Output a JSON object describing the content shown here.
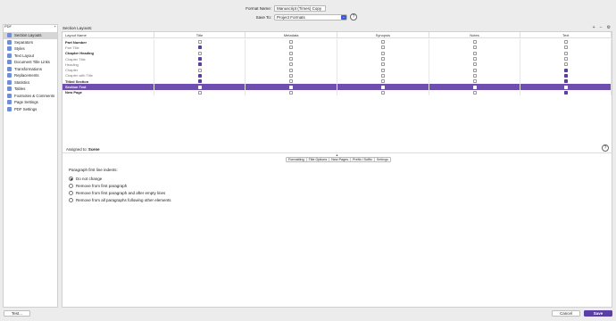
{
  "header": {
    "format_name_label": "Format Name:",
    "format_name_value": "Manuscript (Times) Copy",
    "save_to_label": "Save To:",
    "save_to_value": "Project Formats"
  },
  "sidebar": {
    "label": "PDF",
    "items": [
      {
        "label": "Section Layouts",
        "icon": "layout-icon",
        "selected": true
      },
      {
        "label": "Separators",
        "icon": "separator-icon"
      },
      {
        "label": "Styles",
        "icon": "styles-icon"
      },
      {
        "label": "Text Layout",
        "icon": "text-layout-icon"
      },
      {
        "label": "Document Title Links",
        "icon": "link-icon"
      },
      {
        "label": "Transformations",
        "icon": "transform-icon"
      },
      {
        "label": "Replacements",
        "icon": "replace-icon"
      },
      {
        "label": "Statistics",
        "icon": "stats-icon"
      },
      {
        "label": "Tables",
        "icon": "table-icon"
      },
      {
        "label": "Footnotes & Comments",
        "icon": "footnote-icon"
      },
      {
        "label": "Page Settings",
        "icon": "page-icon"
      },
      {
        "label": "PDF Settings",
        "icon": "pdf-icon"
      }
    ]
  },
  "main": {
    "title": "Section Layouts:",
    "columns": [
      "Layout Name",
      "Title",
      "Metadata",
      "Synopsis",
      "Notes",
      "Text"
    ],
    "rows": [
      {
        "name": "Part Number",
        "style": "bold",
        "checks": [
          false,
          false,
          false,
          false,
          false
        ],
        "selected": false
      },
      {
        "name": "Part Title",
        "style": "gray",
        "checks": [
          true,
          false,
          false,
          false,
          false
        ],
        "selected": false
      },
      {
        "name": "Chapter Heading",
        "style": "bold",
        "checks": [
          false,
          false,
          false,
          false,
          false
        ],
        "selected": false
      },
      {
        "name": "Chapter Title",
        "style": "gray",
        "checks": [
          true,
          false,
          false,
          false,
          false
        ],
        "selected": false
      },
      {
        "name": "Heading",
        "style": "gray",
        "checks": [
          true,
          false,
          false,
          false,
          false
        ],
        "selected": false
      },
      {
        "name": "Chapter",
        "style": "gray",
        "checks": [
          false,
          false,
          false,
          false,
          true
        ],
        "selected": false
      },
      {
        "name": "Chapter with Title",
        "style": "gray",
        "checks": [
          true,
          false,
          false,
          false,
          true
        ],
        "selected": false
      },
      {
        "name": "Titled Section",
        "style": "bold",
        "checks": [
          true,
          false,
          false,
          false,
          true
        ],
        "selected": false
      },
      {
        "name": "Section Text",
        "style": "bold",
        "checks": [
          false,
          false,
          false,
          false,
          true
        ],
        "selected": true
      },
      {
        "name": "New Page",
        "style": "bold",
        "checks": [
          false,
          false,
          false,
          false,
          true
        ],
        "selected": false
      }
    ],
    "assigned_label": "Assigned to:",
    "assigned_value": "Scene",
    "tabs": [
      "Formatting",
      "Title Options",
      "New Pages",
      "Prefix / Suffix",
      "Settings"
    ],
    "active_tab": 4,
    "settings": {
      "title": "Paragraph first line indents:",
      "options": [
        {
          "label": "Do not change",
          "selected": true
        },
        {
          "label": "Remove from first paragraph",
          "selected": false
        },
        {
          "label": "Remove from first paragraph and after empty lines",
          "selected": false
        },
        {
          "label": "Remove from all paragraphs following other elements",
          "selected": false
        }
      ]
    }
  },
  "footer": {
    "test_label": "Test...",
    "cancel_label": "Cancel",
    "save_label": "Save"
  }
}
